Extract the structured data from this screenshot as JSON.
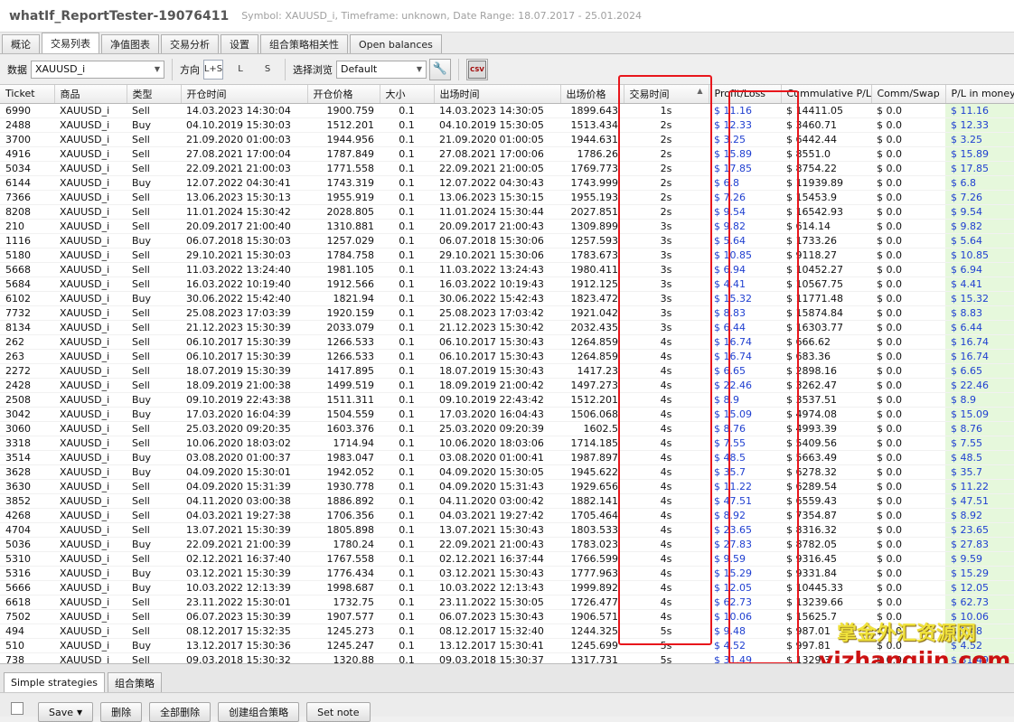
{
  "window": {
    "title": "whatIf_ReportTester-19076411",
    "subtitle": "Symbol: XAUUSD_i, Timeframe: unknown, Date Range: 18.07.2017 - 25.01.2024"
  },
  "tabs": [
    "概论",
    "交易列表",
    "净值图表",
    "交易分析",
    "设置",
    "组合策略相关性",
    "Open balances"
  ],
  "toolbar": {
    "data_label": "数据",
    "data_value": "XAUUSD_i",
    "direction_label": "方向",
    "directions": [
      "L+S",
      "L",
      "S"
    ],
    "view_label": "选择浏览",
    "view_value": "Default",
    "csv_icon_text": "CSV"
  },
  "columns": [
    "Ticket",
    "商品",
    "类型",
    "开仓时间",
    "开仓价格",
    "大小",
    "出场时间",
    "出场价格",
    "交易时间",
    "Profit/Loss",
    "Cummulative P/L",
    "Comm/Swap",
    "P/L in money"
  ],
  "rows": [
    [
      "6990",
      "XAUUSD_i",
      "Sell",
      "14.03.2023 14:30:04",
      "1900.759",
      "0.1",
      "14.03.2023 14:30:05",
      "1899.643",
      "1s",
      "$ 11.16",
      "$ 14411.05",
      "$ 0.0",
      "$ 11.16"
    ],
    [
      "2488",
      "XAUUSD_i",
      "Buy",
      "04.10.2019 15:30:03",
      "1512.201",
      "0.1",
      "04.10.2019 15:30:05",
      "1513.434",
      "2s",
      "$ 12.33",
      "$ 3460.71",
      "$ 0.0",
      "$ 12.33"
    ],
    [
      "3700",
      "XAUUSD_i",
      "Sell",
      "21.09.2020 01:00:03",
      "1944.956",
      "0.1",
      "21.09.2020 01:00:05",
      "1944.631",
      "2s",
      "$ 3.25",
      "$ 6442.44",
      "$ 0.0",
      "$ 3.25"
    ],
    [
      "4916",
      "XAUUSD_i",
      "Sell",
      "27.08.2021 17:00:04",
      "1787.849",
      "0.1",
      "27.08.2021 17:00:06",
      "1786.26",
      "2s",
      "$ 15.89",
      "$ 8551.0",
      "$ 0.0",
      "$ 15.89"
    ],
    [
      "5034",
      "XAUUSD_i",
      "Sell",
      "22.09.2021 21:00:03",
      "1771.558",
      "0.1",
      "22.09.2021 21:00:05",
      "1769.773",
      "2s",
      "$ 17.85",
      "$ 8754.22",
      "$ 0.0",
      "$ 17.85"
    ],
    [
      "6144",
      "XAUUSD_i",
      "Buy",
      "12.07.2022 04:30:41",
      "1743.319",
      "0.1",
      "12.07.2022 04:30:43",
      "1743.999",
      "2s",
      "$ 6.8",
      "$ 11939.89",
      "$ 0.0",
      "$ 6.8"
    ],
    [
      "7366",
      "XAUUSD_i",
      "Sell",
      "13.06.2023 15:30:13",
      "1955.919",
      "0.1",
      "13.06.2023 15:30:15",
      "1955.193",
      "2s",
      "$ 7.26",
      "$ 15453.9",
      "$ 0.0",
      "$ 7.26"
    ],
    [
      "8208",
      "XAUUSD_i",
      "Sell",
      "11.01.2024 15:30:42",
      "2028.805",
      "0.1",
      "11.01.2024 15:30:44",
      "2027.851",
      "2s",
      "$ 9.54",
      "$ 16542.93",
      "$ 0.0",
      "$ 9.54"
    ],
    [
      "210",
      "XAUUSD_i",
      "Sell",
      "20.09.2017 21:00:40",
      "1310.881",
      "0.1",
      "20.09.2017 21:00:43",
      "1309.899",
      "3s",
      "$ 9.82",
      "$ 614.14",
      "$ 0.0",
      "$ 9.82"
    ],
    [
      "1116",
      "XAUUSD_i",
      "Buy",
      "06.07.2018 15:30:03",
      "1257.029",
      "0.1",
      "06.07.2018 15:30:06",
      "1257.593",
      "3s",
      "$ 5.64",
      "$ 1733.26",
      "$ 0.0",
      "$ 5.64"
    ],
    [
      "5180",
      "XAUUSD_i",
      "Sell",
      "29.10.2021 15:30:03",
      "1784.758",
      "0.1",
      "29.10.2021 15:30:06",
      "1783.673",
      "3s",
      "$ 10.85",
      "$ 9118.27",
      "$ 0.0",
      "$ 10.85"
    ],
    [
      "5668",
      "XAUUSD_i",
      "Sell",
      "11.03.2022 13:24:40",
      "1981.105",
      "0.1",
      "11.03.2022 13:24:43",
      "1980.411",
      "3s",
      "$ 6.94",
      "$ 10452.27",
      "$ 0.0",
      "$ 6.94"
    ],
    [
      "5684",
      "XAUUSD_i",
      "Sell",
      "16.03.2022 10:19:40",
      "1912.566",
      "0.1",
      "16.03.2022 10:19:43",
      "1912.125",
      "3s",
      "$ 4.41",
      "$ 10567.75",
      "$ 0.0",
      "$ 4.41"
    ],
    [
      "6102",
      "XAUUSD_i",
      "Buy",
      "30.06.2022 15:42:40",
      "1821.94",
      "0.1",
      "30.06.2022 15:42:43",
      "1823.472",
      "3s",
      "$ 15.32",
      "$ 11771.48",
      "$ 0.0",
      "$ 15.32"
    ],
    [
      "7732",
      "XAUUSD_i",
      "Sell",
      "25.08.2023 17:03:39",
      "1920.159",
      "0.1",
      "25.08.2023 17:03:42",
      "1921.042",
      "3s",
      "$ 8.83",
      "$ 15874.84",
      "$ 0.0",
      "$ 8.83"
    ],
    [
      "8134",
      "XAUUSD_i",
      "Sell",
      "21.12.2023 15:30:39",
      "2033.079",
      "0.1",
      "21.12.2023 15:30:42",
      "2032.435",
      "3s",
      "$ 6.44",
      "$ 16303.77",
      "$ 0.0",
      "$ 6.44"
    ],
    [
      "262",
      "XAUUSD_i",
      "Sell",
      "06.10.2017 15:30:39",
      "1266.533",
      "0.1",
      "06.10.2017 15:30:43",
      "1264.859",
      "4s",
      "$ 16.74",
      "$ 666.62",
      "$ 0.0",
      "$ 16.74"
    ],
    [
      "263",
      "XAUUSD_i",
      "Sell",
      "06.10.2017 15:30:39",
      "1266.533",
      "0.1",
      "06.10.2017 15:30:43",
      "1264.859",
      "4s",
      "$ 16.74",
      "$ 683.36",
      "$ 0.0",
      "$ 16.74"
    ],
    [
      "2272",
      "XAUUSD_i",
      "Sell",
      "18.07.2019 15:30:39",
      "1417.895",
      "0.1",
      "18.07.2019 15:30:43",
      "1417.23",
      "4s",
      "$ 6.65",
      "$ 2898.16",
      "$ 0.0",
      "$ 6.65"
    ],
    [
      "2428",
      "XAUUSD_i",
      "Sell",
      "18.09.2019 21:00:38",
      "1499.519",
      "0.1",
      "18.09.2019 21:00:42",
      "1497.273",
      "4s",
      "$ 22.46",
      "$ 3262.47",
      "$ 0.0",
      "$ 22.46"
    ],
    [
      "2508",
      "XAUUSD_i",
      "Buy",
      "09.10.2019 22:43:38",
      "1511.311",
      "0.1",
      "09.10.2019 22:43:42",
      "1512.201",
      "4s",
      "$ 8.9",
      "$ 3537.51",
      "$ 0.0",
      "$ 8.9"
    ],
    [
      "3042",
      "XAUUSD_i",
      "Buy",
      "17.03.2020 16:04:39",
      "1504.559",
      "0.1",
      "17.03.2020 16:04:43",
      "1506.068",
      "4s",
      "$ 15.09",
      "$ 4974.08",
      "$ 0.0",
      "$ 15.09"
    ],
    [
      "3060",
      "XAUUSD_i",
      "Sell",
      "25.03.2020 09:20:35",
      "1603.376",
      "0.1",
      "25.03.2020 09:20:39",
      "1602.5",
      "4s",
      "$ 8.76",
      "$ 4993.39",
      "$ 0.0",
      "$ 8.76"
    ],
    [
      "3318",
      "XAUUSD_i",
      "Sell",
      "10.06.2020 18:03:02",
      "1714.94",
      "0.1",
      "10.06.2020 18:03:06",
      "1714.185",
      "4s",
      "$ 7.55",
      "$ 5409.56",
      "$ 0.0",
      "$ 7.55"
    ],
    [
      "3514",
      "XAUUSD_i",
      "Buy",
      "03.08.2020 01:00:37",
      "1983.047",
      "0.1",
      "03.08.2020 01:00:41",
      "1987.897",
      "4s",
      "$ 48.5",
      "$ 5663.49",
      "$ 0.0",
      "$ 48.5"
    ],
    [
      "3628",
      "XAUUSD_i",
      "Buy",
      "04.09.2020 15:30:01",
      "1942.052",
      "0.1",
      "04.09.2020 15:30:05",
      "1945.622",
      "4s",
      "$ 35.7",
      "$ 6278.32",
      "$ 0.0",
      "$ 35.7"
    ],
    [
      "3630",
      "XAUUSD_i",
      "Sell",
      "04.09.2020 15:31:39",
      "1930.778",
      "0.1",
      "04.09.2020 15:31:43",
      "1929.656",
      "4s",
      "$ 11.22",
      "$ 6289.54",
      "$ 0.0",
      "$ 11.22"
    ],
    [
      "3852",
      "XAUUSD_i",
      "Sell",
      "04.11.2020 03:00:38",
      "1886.892",
      "0.1",
      "04.11.2020 03:00:42",
      "1882.141",
      "4s",
      "$ 47.51",
      "$ 6559.43",
      "$ 0.0",
      "$ 47.51"
    ],
    [
      "4268",
      "XAUUSD_i",
      "Sell",
      "04.03.2021 19:27:38",
      "1706.356",
      "0.1",
      "04.03.2021 19:27:42",
      "1705.464",
      "4s",
      "$ 8.92",
      "$ 7354.87",
      "$ 0.0",
      "$ 8.92"
    ],
    [
      "4704",
      "XAUUSD_i",
      "Sell",
      "13.07.2021 15:30:39",
      "1805.898",
      "0.1",
      "13.07.2021 15:30:43",
      "1803.533",
      "4s",
      "$ 23.65",
      "$ 8316.32",
      "$ 0.0",
      "$ 23.65"
    ],
    [
      "5036",
      "XAUUSD_i",
      "Buy",
      "22.09.2021 21:00:39",
      "1780.24",
      "0.1",
      "22.09.2021 21:00:43",
      "1783.023",
      "4s",
      "$ 27.83",
      "$ 8782.05",
      "$ 0.0",
      "$ 27.83"
    ],
    [
      "5310",
      "XAUUSD_i",
      "Sell",
      "02.12.2021 16:37:40",
      "1767.558",
      "0.1",
      "02.12.2021 16:37:44",
      "1766.599",
      "4s",
      "$ 9.59",
      "$ 9316.45",
      "$ 0.0",
      "$ 9.59"
    ],
    [
      "5316",
      "XAUUSD_i",
      "Buy",
      "03.12.2021 15:30:39",
      "1776.434",
      "0.1",
      "03.12.2021 15:30:43",
      "1777.963",
      "4s",
      "$ 15.29",
      "$ 9331.84",
      "$ 0.0",
      "$ 15.29"
    ],
    [
      "5666",
      "XAUUSD_i",
      "Buy",
      "10.03.2022 12:13:39",
      "1998.687",
      "0.1",
      "10.03.2022 12:13:43",
      "1999.892",
      "4s",
      "$ 12.05",
      "$ 10445.33",
      "$ 0.0",
      "$ 12.05"
    ],
    [
      "6618",
      "XAUUSD_i",
      "Sell",
      "23.11.2022 15:30:01",
      "1732.75",
      "0.1",
      "23.11.2022 15:30:05",
      "1726.477",
      "4s",
      "$ 62.73",
      "$ 13239.66",
      "$ 0.0",
      "$ 62.73"
    ],
    [
      "7502",
      "XAUUSD_i",
      "Sell",
      "06.07.2023 15:30:39",
      "1907.577",
      "0.1",
      "06.07.2023 15:30:43",
      "1906.571",
      "4s",
      "$ 10.06",
      "$ 15625.7",
      "$ 0.0",
      "$ 10.06"
    ],
    [
      "494",
      "XAUUSD_i",
      "Sell",
      "08.12.2017 15:32:35",
      "1245.273",
      "0.1",
      "08.12.2017 15:32:40",
      "1244.325",
      "5s",
      "$ 9.48",
      "$ 987.01",
      "$ 0.0",
      "$ 9.48"
    ],
    [
      "510",
      "XAUUSD_i",
      "Buy",
      "13.12.2017 15:30:36",
      "1245.247",
      "0.1",
      "13.12.2017 15:30:41",
      "1245.699",
      "5s",
      "$ 4.52",
      "$ 997.81",
      "$ 0.0",
      "$ 4.52"
    ],
    [
      "738",
      "XAUUSD_i",
      "Sell",
      "09.03.2018 15:30:32",
      "1320.88",
      "0.1",
      "09.03.2018 15:30:37",
      "1317.731",
      "5s",
      "$ 31.49",
      "$ 1329.3",
      "$ 0.0",
      "$ 31.49"
    ]
  ],
  "bottom_tabs": [
    "Simple strategies",
    "组合策略"
  ],
  "bottom_buttons": [
    "Save",
    "删除",
    "全部删除",
    "创建组合策略",
    "Set note"
  ],
  "watermark": {
    "line1": "掌金外汇资源网",
    "line2": "yizhangjin.com"
  },
  "colors": {
    "pl_blue": "#1f3fd0",
    "money_bg": "#e6f8dc",
    "highlight_red": "#e8161c"
  }
}
